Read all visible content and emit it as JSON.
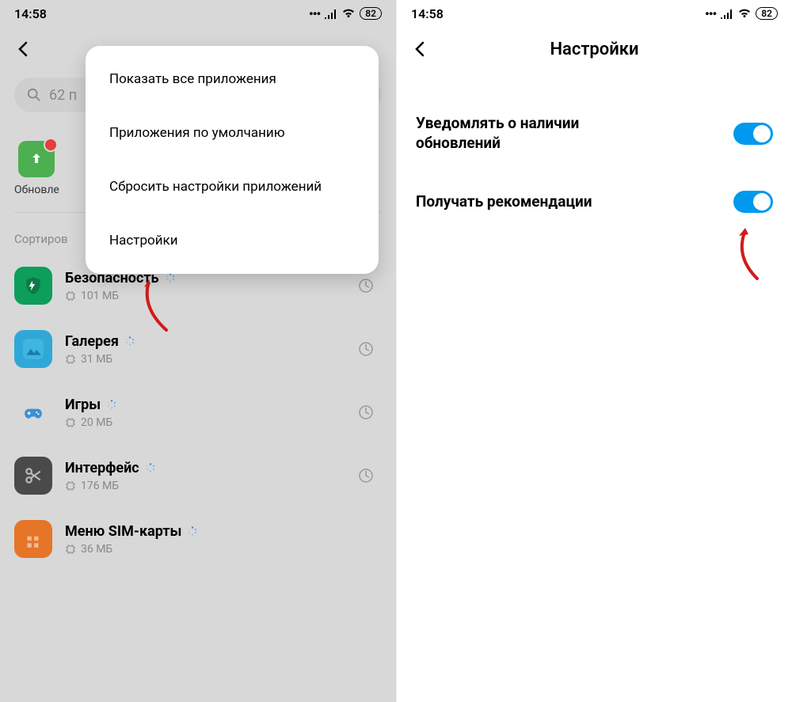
{
  "status": {
    "time": "14:58",
    "battery": "82"
  },
  "left": {
    "search": "62 п",
    "update_label": "Обновле",
    "sort_label": "Сортиров",
    "popup": {
      "items": [
        "Показать все приложения",
        "Приложения по умолчанию",
        "Сбросить настройки приложений",
        "Настройки"
      ]
    },
    "apps": [
      {
        "name": "Безопасность",
        "size": "101 МБ"
      },
      {
        "name": "Галерея",
        "size": "31 МБ"
      },
      {
        "name": "Игры",
        "size": "20 МБ"
      },
      {
        "name": "Интерфейс",
        "size": "176 МБ"
      },
      {
        "name": "Меню SIM-карты",
        "size": "36 МБ"
      }
    ]
  },
  "right": {
    "title": "Настройки",
    "settings": [
      {
        "label": "Уведомлять о наличии обновлений"
      },
      {
        "label": "Получать рекомендации"
      }
    ]
  }
}
